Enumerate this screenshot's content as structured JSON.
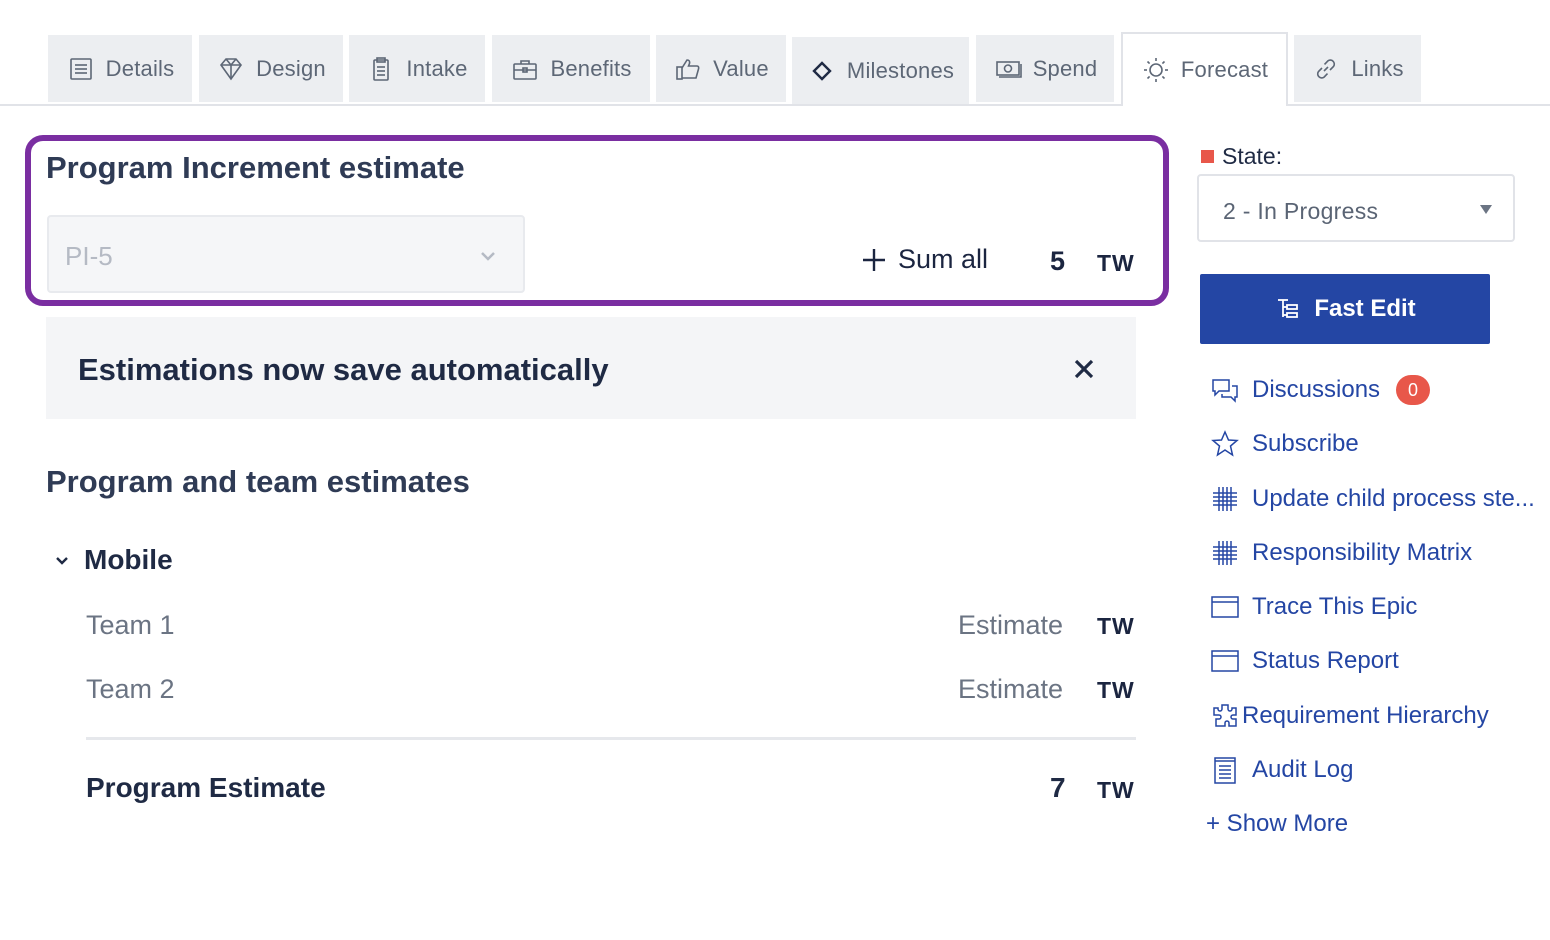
{
  "tabs": [
    {
      "label": "Details",
      "icon": "document-icon"
    },
    {
      "label": "Design",
      "icon": "diamond-icon"
    },
    {
      "label": "Intake",
      "icon": "clipboard-icon"
    },
    {
      "label": "Benefits",
      "icon": "briefcase-icon"
    },
    {
      "label": "Value",
      "icon": "thumbs-up-icon"
    },
    {
      "label": "Milestones",
      "icon": "milestone-icon"
    },
    {
      "label": "Spend",
      "icon": "money-icon"
    },
    {
      "label": "Forecast",
      "icon": "sun-icon",
      "active": true
    },
    {
      "label": "Links",
      "icon": "link-icon"
    }
  ],
  "pi_estimate": {
    "title": "Program Increment estimate",
    "select_value": "PI-5",
    "sum_all_label": "Sum all",
    "value": "5",
    "unit": "TW"
  },
  "notice": {
    "text": "Estimations now save automatically"
  },
  "estimates": {
    "title": "Program and team estimates",
    "group_label": "Mobile",
    "teams": [
      {
        "name": "Team 1",
        "estimate_placeholder": "Estimate",
        "unit": "TW"
      },
      {
        "name": "Team 2",
        "estimate_placeholder": "Estimate",
        "unit": "TW"
      }
    ],
    "program_label": "Program Estimate",
    "program_value": "7",
    "program_unit": "TW"
  },
  "sidebar": {
    "state_label": "State:",
    "state_value": "2 - In Progress",
    "state_color": "#e8574a",
    "fast_edit_label": "Fast Edit",
    "links": [
      {
        "label": "Discussions",
        "icon": "chat-icon",
        "badge": "0"
      },
      {
        "label": "Subscribe",
        "icon": "star-icon"
      },
      {
        "label": "Update child process ste...",
        "icon": "grid-icon"
      },
      {
        "label": "Responsibility Matrix",
        "icon": "grid-icon"
      },
      {
        "label": "Trace This Epic",
        "icon": "window-icon"
      },
      {
        "label": "Status Report",
        "icon": "window-icon"
      },
      {
        "label": "Requirement Hierarchy",
        "icon": "puzzle-icon"
      },
      {
        "label": "Audit Log",
        "icon": "log-icon"
      }
    ],
    "show_more_label": "+ Show More"
  },
  "colors": {
    "accent": "#2446a4",
    "highlight": "#7a2ea1",
    "badge": "#e8574a"
  }
}
